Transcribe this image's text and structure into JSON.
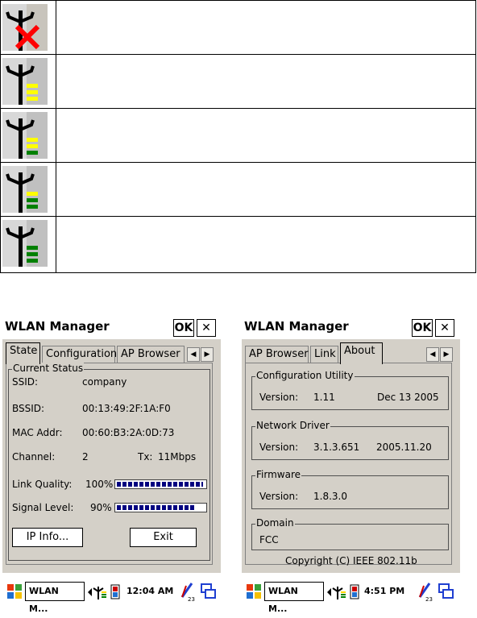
{
  "legend": {
    "rows": [
      {
        "icon": "antenna-no-signal-icon",
        "bars": 0,
        "description": ""
      },
      {
        "icon": "antenna-signal-1-icon",
        "bars": 1,
        "description": ""
      },
      {
        "icon": "antenna-signal-2-icon",
        "bars": 2,
        "description": ""
      },
      {
        "icon": "antenna-signal-3-icon",
        "bars": 3,
        "description": ""
      },
      {
        "icon": "antenna-signal-4-icon",
        "bars": 4,
        "description": ""
      }
    ]
  },
  "colors": {
    "signal_yellow": "#ffff00",
    "signal_green": "#008000",
    "error_red": "#ff0000",
    "progress_blue": "#000080",
    "dialog_gray": "#d4d0c8"
  },
  "window_left": {
    "title": "WLAN Manager",
    "ok_label": "OK",
    "close_label": "✕",
    "tabs": [
      "State",
      "Configuration",
      "AP Browser"
    ],
    "active_tab": "State",
    "group_title": "Current Status",
    "fields": {
      "ssid_label": "SSID:",
      "ssid_value": "company",
      "bssid_label": "BSSID:",
      "bssid_value": "00:13:49:2F:1A:F0",
      "mac_label": "MAC Addr:",
      "mac_value": "00:60:B3:2A:0D:73",
      "channel_label": "Channel:",
      "channel_value": "2",
      "tx_label": "Tx:",
      "tx_value": "11Mbps",
      "link_quality_label": "Link Quality:",
      "link_quality_value": "100%",
      "signal_level_label": "Signal Level:",
      "signal_level_value": "90%"
    },
    "link_quality_fraction": 1.0,
    "signal_level_fraction": 0.9,
    "buttons": {
      "ip_info": "IP Info...",
      "exit": "Exit"
    },
    "taskbar": {
      "start_icon": "windows-flag-icon",
      "app": "WLAN M...",
      "time": "12:04 AM"
    }
  },
  "window_right": {
    "title": "WLAN Manager",
    "ok_label": "OK",
    "close_label": "✕",
    "tabs": [
      "AP Browser",
      "Link",
      "About"
    ],
    "active_tab": "About",
    "config_group": "Configuration Utility",
    "config_version_label": "Version:",
    "config_version": "1.11",
    "config_date": "Dec 13 2005",
    "driver_group": "Network Driver",
    "driver_version_label": "Version:",
    "driver_version": "3.1.3.651",
    "driver_date": "2005.11.20",
    "firmware_group": "Firmware",
    "firmware_version_label": "Version:",
    "firmware_version": "1.8.3.0",
    "domain_group": "Domain",
    "domain_value": "FCC",
    "copyright": "Copyright (C)  IEEE  802.11b",
    "taskbar": {
      "start_icon": "windows-flag-icon",
      "app": "WLAN M...",
      "time": "4:51 PM"
    }
  }
}
